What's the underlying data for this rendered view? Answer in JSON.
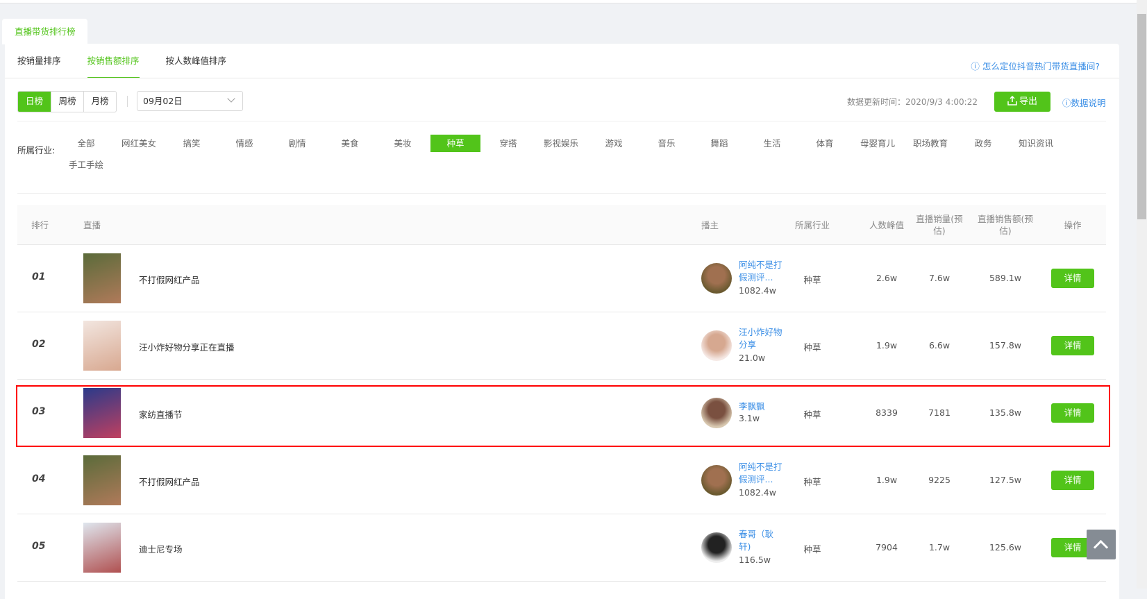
{
  "tab": "直播带货排行榜",
  "sort_tabs": [
    "按销量排序",
    "按销售额排序",
    "按人数峰值排序"
  ],
  "active_sort": 1,
  "help_link": "ⓘ 怎么定位抖音热门带货直播间?",
  "period": [
    "日榜",
    "周榜",
    "月榜"
  ],
  "active_period": 0,
  "date": "09月02日",
  "update_time": "数据更新时间：2020/9/3 4:00:22",
  "export": "导出",
  "data_explain": "ⓘ数据说明",
  "industry_label": "所属行业:",
  "industries": [
    "全部",
    "网红美女",
    "搞笑",
    "情感",
    "剧情",
    "美食",
    "美妆",
    "种草",
    "穿搭",
    "影视娱乐",
    "游戏",
    "音乐",
    "舞蹈",
    "生活",
    "体育",
    "母婴育儿",
    "职场教育",
    "政务",
    "知识资讯",
    "手工手绘"
  ],
  "active_industry": "种草",
  "columns": [
    "排行",
    "直播",
    "播主",
    "所属行业",
    "人数峰值",
    "直播销量(预估)",
    "直播销售额(预估)",
    "操作"
  ],
  "rows": [
    {
      "rank": "01",
      "title": "不打假网红产品",
      "anchor": "阿纯不是打假测评...",
      "fans": "1082.4w",
      "industry": "种草",
      "peak": "2.6w",
      "volume": "7.6w",
      "sales": "589.1w",
      "action": "详情"
    },
    {
      "rank": "02",
      "title": "汪小炸好物分享正在直播",
      "anchor": "汪小炸好物分享",
      "fans": "21.0w",
      "industry": "种草",
      "peak": "1.9w",
      "volume": "6.6w",
      "sales": "157.8w",
      "action": "详情"
    },
    {
      "rank": "03",
      "title": "家纺直播节",
      "anchor": "李飘飘",
      "fans": "3.1w",
      "industry": "种草",
      "peak": "8339",
      "volume": "7181",
      "sales": "135.8w",
      "action": "详情"
    },
    {
      "rank": "04",
      "title": "不打假网红产品",
      "anchor": "阿纯不是打假测评...",
      "fans": "1082.4w",
      "industry": "种草",
      "peak": "1.9w",
      "volume": "9225",
      "sales": "127.5w",
      "action": "详情"
    },
    {
      "rank": "05",
      "title": "迪士尼专场",
      "anchor": "春哥（耿轩)",
      "fans": "116.5w",
      "industry": "种草",
      "peak": "7904",
      "volume": "1.7w",
      "sales": "125.6w",
      "action": "详情"
    }
  ],
  "colors": {
    "accent": "#52c41a",
    "link": "#3a8ee6",
    "highlight": "#ff0000"
  }
}
